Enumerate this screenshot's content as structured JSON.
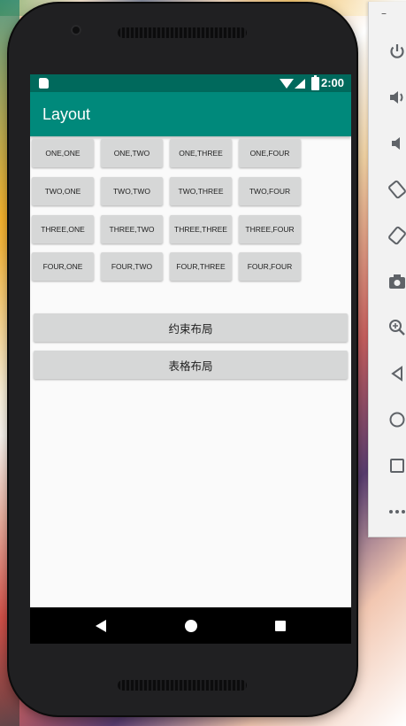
{
  "status_bar": {
    "time": "2:00"
  },
  "app_bar": {
    "title": "Layout"
  },
  "grid": {
    "rows": [
      [
        "ONE,ONE",
        "ONE,TWO",
        "ONE,THREE",
        "ONE,FOUR"
      ],
      [
        "TWO,ONE",
        "TWO,TWO",
        "TWO,THREE",
        "TWO,FOUR"
      ],
      [
        "THREE,ONE",
        "THREE,TWO",
        "THREE,THREE",
        "THREE,FOUR"
      ],
      [
        "FOUR,ONE",
        "FOUR,TWO",
        "FOUR,THREE",
        "FOUR,FOUR"
      ]
    ]
  },
  "buttons": {
    "constraint_layout": "约束布局",
    "table_layout": "表格布局"
  },
  "emulator_toolbar": {
    "minimize": "–",
    "tools": [
      "power-icon",
      "volume-up-icon",
      "volume-down-icon",
      "rotate-left-icon",
      "rotate-right-icon",
      "camera-icon",
      "zoom-icon",
      "back-icon",
      "home-icon",
      "overview-icon",
      "more-icon"
    ]
  },
  "colors": {
    "status_bar": "#00695c",
    "app_bar": "#00897b",
    "button": "#d6d7d7",
    "screen_bg": "#fafafa"
  }
}
